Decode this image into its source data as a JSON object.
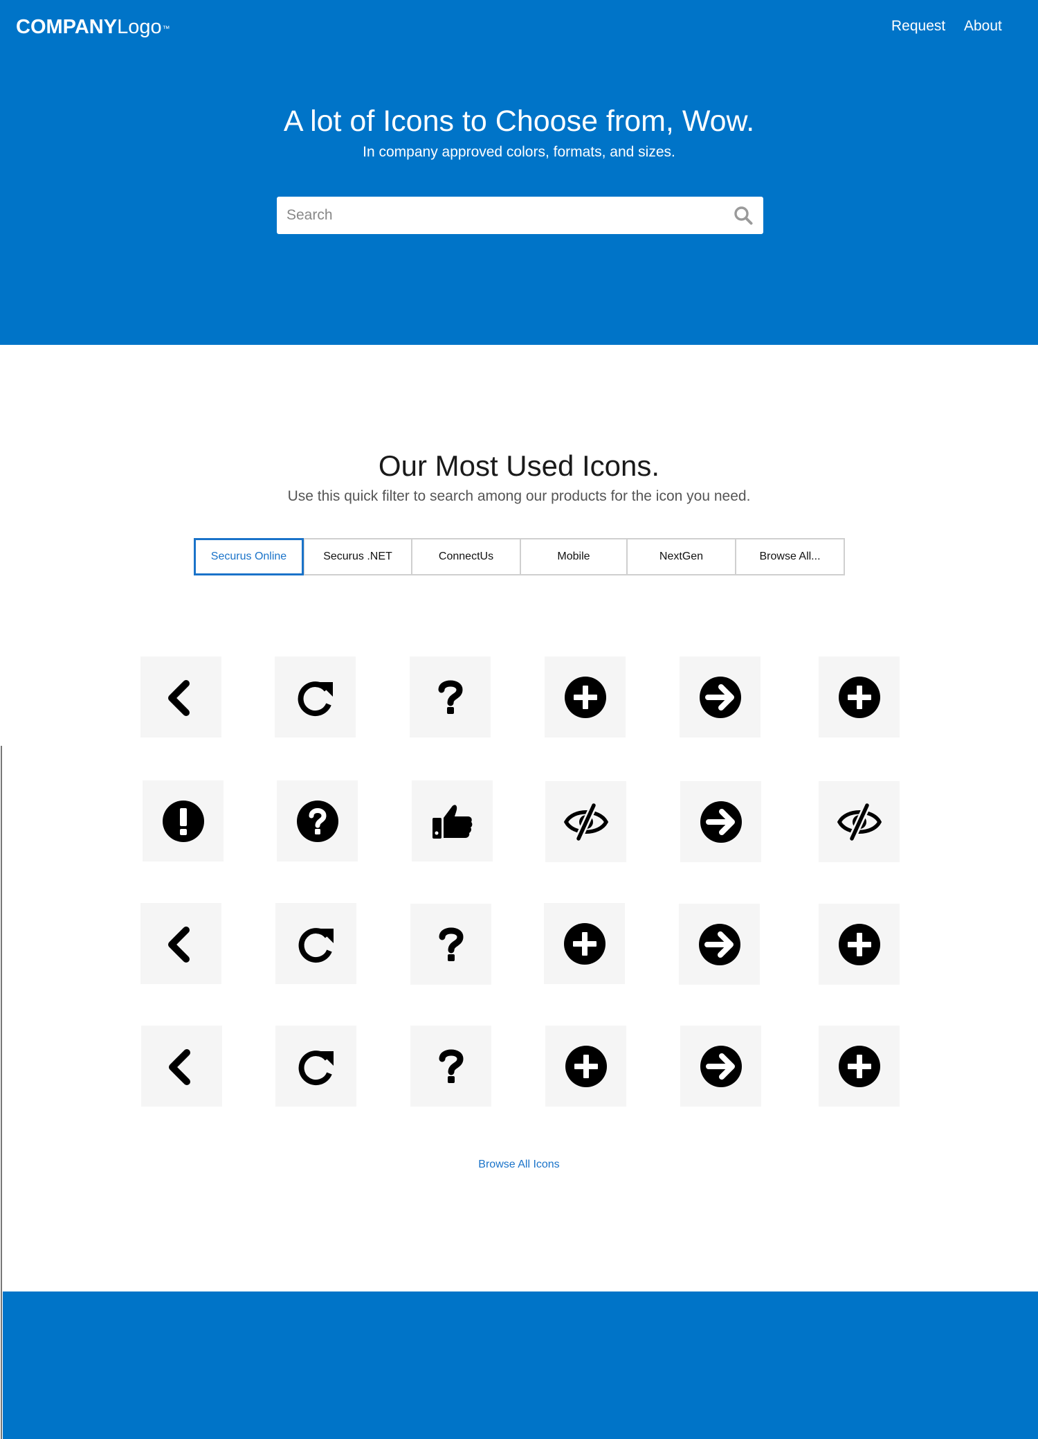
{
  "header": {
    "logo": {
      "bold": "COMPANY",
      "light": "Logo",
      "tm": "™"
    },
    "nav": [
      {
        "label": "Request"
      },
      {
        "label": "About"
      }
    ],
    "title": "A lot of Icons to Choose from, Wow.",
    "subtitle": "In company approved colors, formats, and sizes.",
    "search": {
      "placeholder": "Search",
      "value": ""
    }
  },
  "main": {
    "title": "Our Most Used Icons.",
    "subtitle": "Use this quick filter to search among our products for the icon you need.",
    "filter_tabs": [
      {
        "label": "Securus Online",
        "active": true
      },
      {
        "label": "Securus .NET",
        "active": false
      },
      {
        "label": "ConnectUs",
        "active": false
      },
      {
        "label": "Mobile",
        "active": false
      },
      {
        "label": "NextGen",
        "active": false
      },
      {
        "label": "Browse All...",
        "active": false
      }
    ],
    "icon_grid": [
      [
        "chevron-left-icon",
        "redo-icon",
        "question-icon",
        "plus-circle-icon",
        "arrow-right-circle-icon",
        "plus-circle-icon"
      ],
      [
        "exclamation-circle-icon",
        "question-circle-icon",
        "thumbs-up-icon",
        "eye-slash-icon",
        "arrow-right-circle-icon",
        "eye-slash-icon"
      ],
      [
        "chevron-left-icon",
        "redo-icon",
        "question-icon",
        "plus-circle-icon",
        "arrow-right-circle-icon",
        "plus-circle-icon"
      ],
      [
        "chevron-left-icon",
        "redo-icon",
        "question-icon",
        "plus-circle-icon",
        "arrow-right-circle-icon",
        "plus-circle-icon"
      ]
    ],
    "browse_all_label": "Browse All Icons"
  },
  "colors": {
    "brand_blue": "#0074c8",
    "link_blue": "#1a73c9",
    "tile_bg": "#f5f5f5",
    "icon_color": "#000000"
  }
}
